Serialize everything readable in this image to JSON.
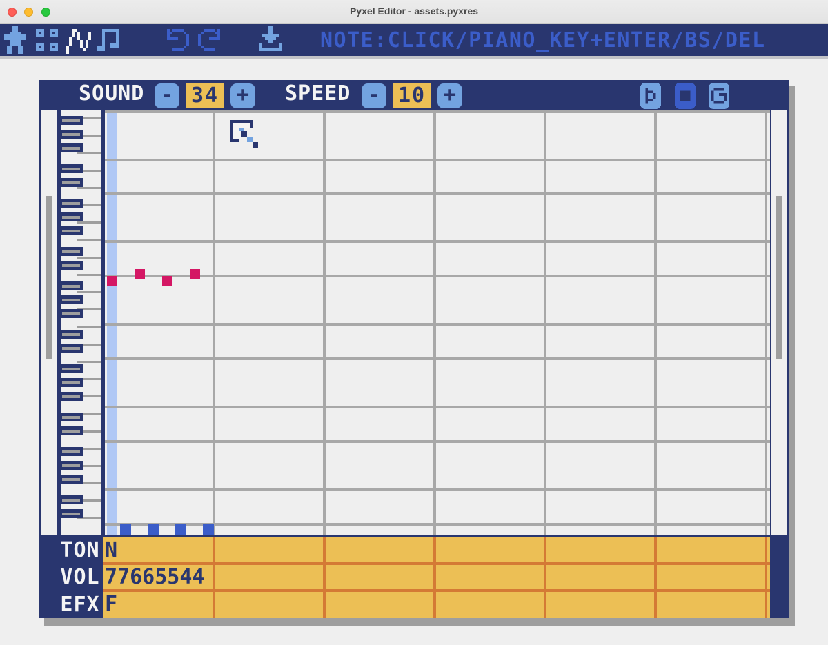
{
  "window": {
    "title": "Pyxel Editor - assets.pyxres"
  },
  "toolbar": {
    "help_text": "NOTE:CLICK/PIANO_KEY+ENTER/BS/DEL",
    "icons": [
      "image-editor-icon",
      "tilemap-editor-icon",
      "sound-editor-icon",
      "music-editor-icon",
      "undo-icon",
      "redo-icon",
      "save-icon"
    ]
  },
  "sound": {
    "label": "SOUND",
    "value": "34",
    "minus": "-",
    "plus": "+"
  },
  "speed": {
    "label": "SPEED",
    "value": "10",
    "minus": "-",
    "plus": "+"
  },
  "rows": {
    "ton": {
      "label": "TON",
      "value": "N"
    },
    "vol": {
      "label": "VOL",
      "value": "77665544"
    },
    "efx": {
      "label": "EFX",
      "value": "F"
    }
  },
  "colors": {
    "navy": "#29366f",
    "blue": "#3b5dc9",
    "light_blue": "#73a3e0",
    "yellow": "#ecbf55",
    "orange": "#d47a35",
    "note": "#d41764",
    "playhead": "#b0c8f5"
  }
}
